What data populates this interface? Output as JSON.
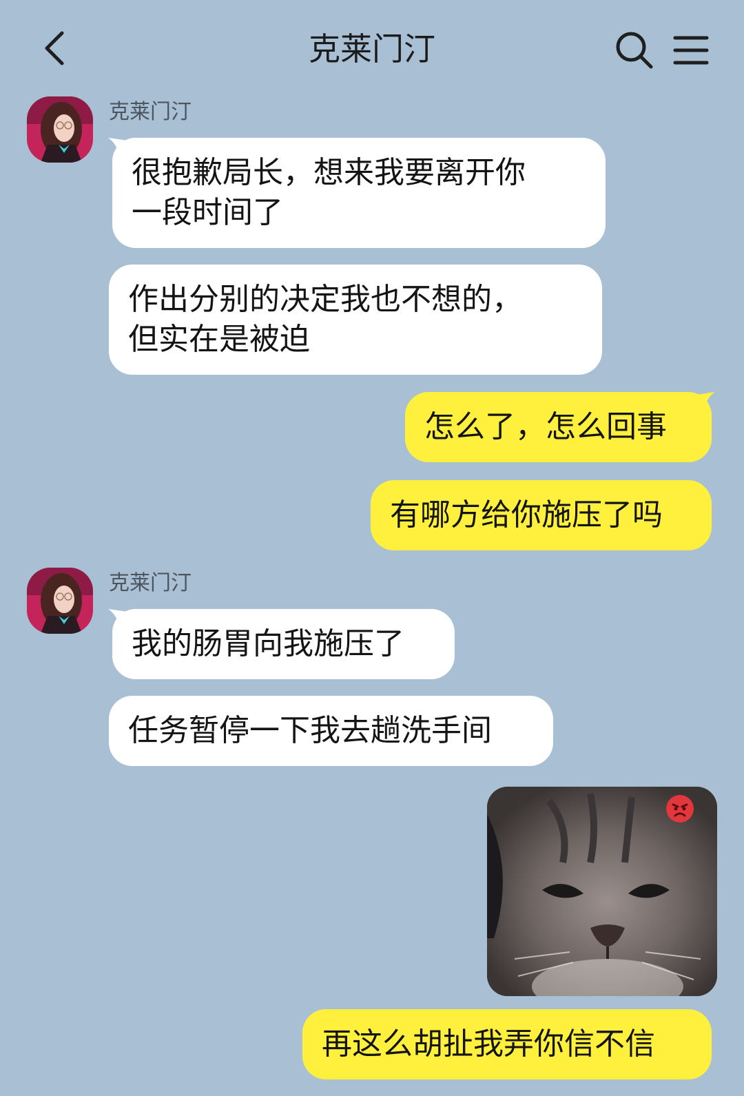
{
  "header": {
    "title": "克莱门汀",
    "back_icon": "chevron-left-icon",
    "search_icon": "search-icon",
    "menu_icon": "hamburger-menu-icon"
  },
  "colors": {
    "background": "#a9bfd4",
    "incoming_bubble": "#ffffff",
    "outgoing_bubble": "#fef03c"
  },
  "messages": [
    {
      "group": 1,
      "sender": "克莱门汀",
      "direction": "incoming",
      "bubbles": [
        {
          "lines": [
            "很抱歉局长，想来我要离开你",
            "一段时间了"
          ]
        },
        {
          "lines": [
            "作出分别的决定我也不想的，",
            "但实在是被迫"
          ]
        }
      ]
    },
    {
      "group": 2,
      "direction": "outgoing",
      "bubbles": [
        {
          "lines": [
            "怎么了，怎么回事"
          ]
        },
        {
          "lines": [
            "有哪方给你施压了吗"
          ]
        }
      ]
    },
    {
      "group": 3,
      "sender": "克莱门汀",
      "direction": "incoming",
      "bubbles": [
        {
          "lines": [
            "我的肠胃向我施压了"
          ]
        },
        {
          "lines": [
            "任务暂停一下我去趟洗手间"
          ]
        }
      ]
    },
    {
      "group": 4,
      "direction": "outgoing",
      "image": {
        "subject": "angry-kitten-sticker",
        "badge_icon": "angry-face-emoji-icon"
      },
      "bubbles": [
        {
          "lines": [
            "再这么胡扯我弄你信不信"
          ]
        }
      ]
    }
  ]
}
